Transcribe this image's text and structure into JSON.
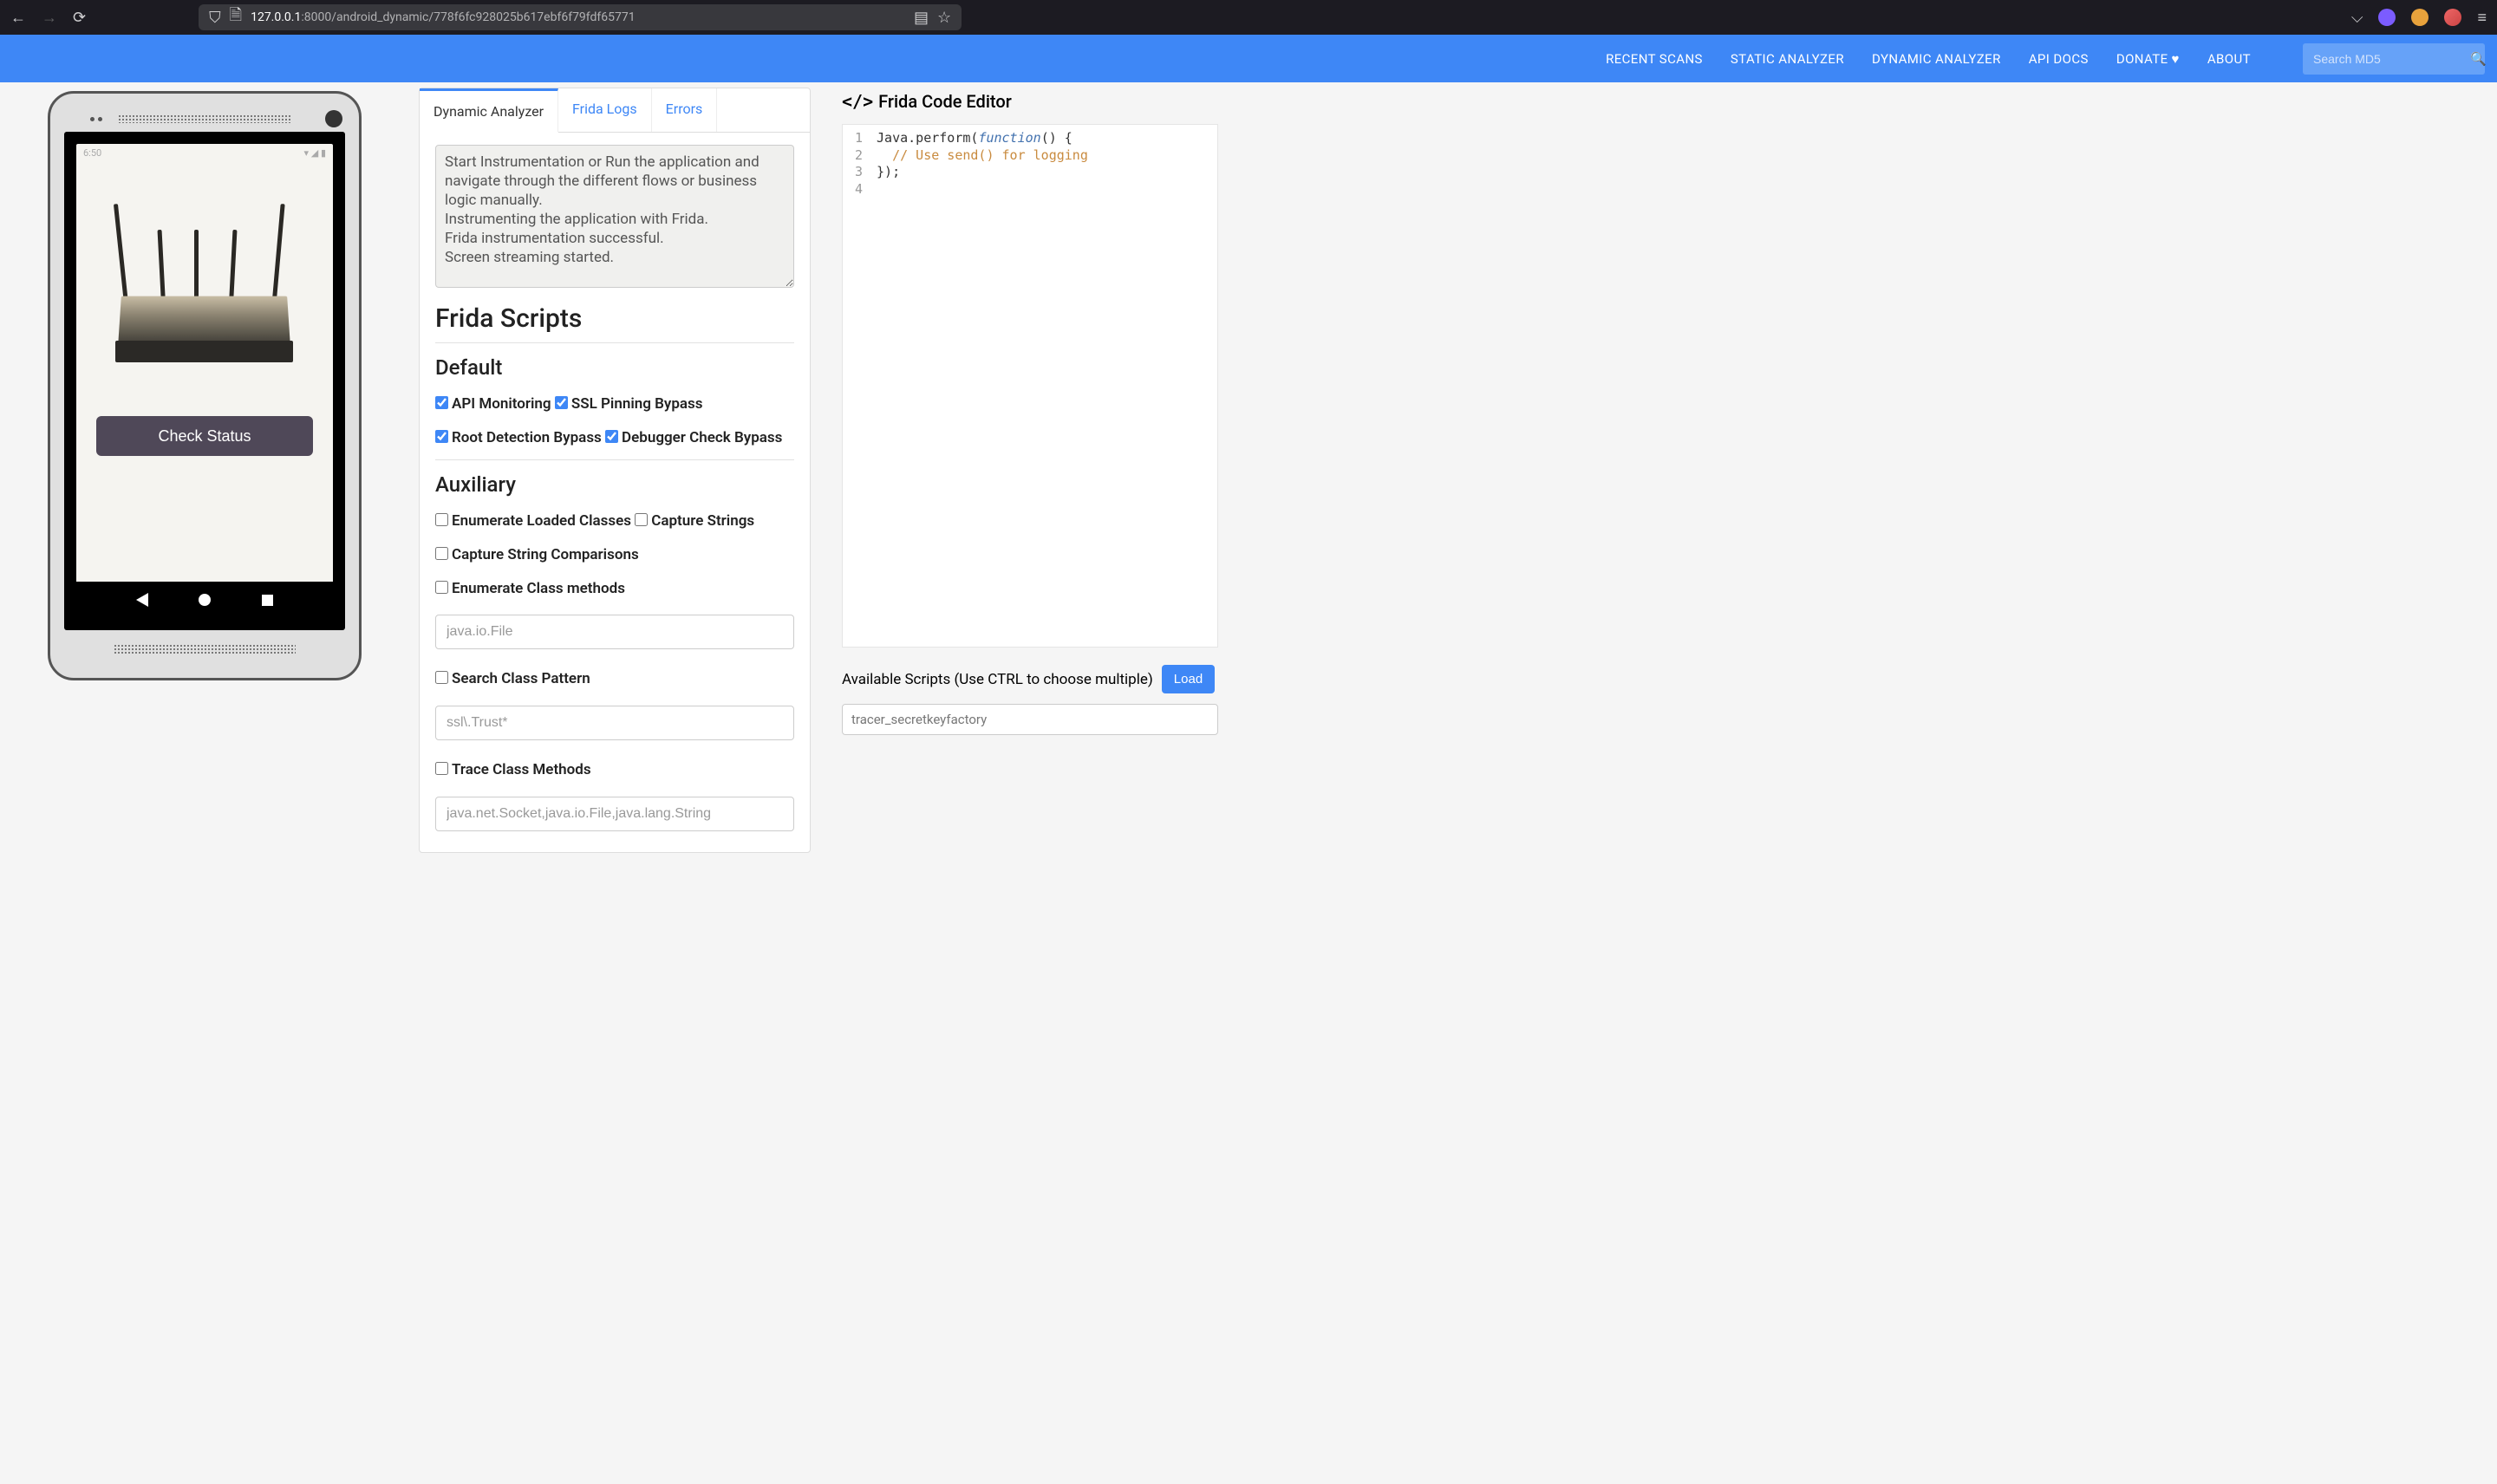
{
  "browser": {
    "url_host": "127.0.0.1",
    "url_port": ":8000",
    "url_path": "/android_dynamic/778f6fc928025b617ebf6f79fdf65771"
  },
  "nav": {
    "recent_scans": "RECENT SCANS",
    "static_analyzer": "STATIC ANALYZER",
    "dynamic_analyzer": "DYNAMIC ANALYZER",
    "api_docs": "API DOCS",
    "donate": "DONATE",
    "about": "ABOUT",
    "search_placeholder": "Search MD5"
  },
  "phone": {
    "time": "6:50",
    "button": "Check Status"
  },
  "tabs": {
    "dynamic": "Dynamic Analyzer",
    "frida_logs": "Frida Logs",
    "errors": "Errors"
  },
  "log": "Start Instrumentation or Run the application and navigate through the different flows or business logic manually.\nInstrumenting the application with Frida.\nFrida instrumentation successful.\nScreen streaming started.",
  "scripts": {
    "title": "Frida Scripts",
    "default_h": "Default",
    "api_monitoring": "API Monitoring",
    "ssl_pinning": "SSL Pinning Bypass",
    "root_detection": "Root Detection Bypass",
    "debugger_check": "Debugger Check Bypass",
    "aux_h": "Auxiliary",
    "enum_loaded": "Enumerate Loaded Classes",
    "capture_strings": "Capture Strings",
    "capture_string_cmp": "Capture String Comparisons",
    "enum_methods": "Enumerate Class methods",
    "enum_methods_ph": "java.io.File",
    "search_pattern": "Search Class Pattern",
    "search_pattern_ph": "ssl\\.Trust*",
    "trace_methods": "Trace Class Methods",
    "trace_methods_ph": "java.net.Socket,java.io.File,java.lang.String"
  },
  "editor": {
    "title": "Frida Code Editor",
    "lines": {
      "l1_a": "Java.perform(",
      "l1_b": "function",
      "l1_c": "() {",
      "l2": "// Use send() for logging",
      "l3": "});"
    },
    "avail_label": "Available Scripts (Use CTRL to choose multiple)",
    "load": "Load",
    "select_hint": "tracer_secretkeyfactory"
  }
}
